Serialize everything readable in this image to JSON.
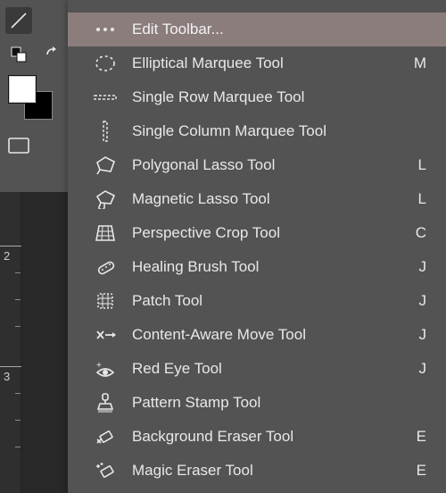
{
  "ruler": {
    "marks": [
      "2",
      "3"
    ]
  },
  "flyout": {
    "items": [
      {
        "label": "Edit Toolbar...",
        "shortcut": "",
        "highlight": true
      },
      {
        "label": "Elliptical Marquee Tool",
        "shortcut": "M",
        "highlight": false
      },
      {
        "label": "Single Row Marquee Tool",
        "shortcut": "",
        "highlight": false
      },
      {
        "label": "Single Column Marquee Tool",
        "shortcut": "",
        "highlight": false
      },
      {
        "label": "Polygonal Lasso Tool",
        "shortcut": "L",
        "highlight": false
      },
      {
        "label": "Magnetic Lasso Tool",
        "shortcut": "L",
        "highlight": false
      },
      {
        "label": "Perspective Crop Tool",
        "shortcut": "C",
        "highlight": false
      },
      {
        "label": "Healing Brush Tool",
        "shortcut": "J",
        "highlight": false
      },
      {
        "label": "Patch Tool",
        "shortcut": "J",
        "highlight": false
      },
      {
        "label": "Content-Aware Move Tool",
        "shortcut": "J",
        "highlight": false
      },
      {
        "label": "Red Eye Tool",
        "shortcut": "J",
        "highlight": false
      },
      {
        "label": "Pattern Stamp Tool",
        "shortcut": "",
        "highlight": false
      },
      {
        "label": "Background Eraser Tool",
        "shortcut": "E",
        "highlight": false
      },
      {
        "label": "Magic Eraser Tool",
        "shortcut": "E",
        "highlight": false
      }
    ]
  }
}
